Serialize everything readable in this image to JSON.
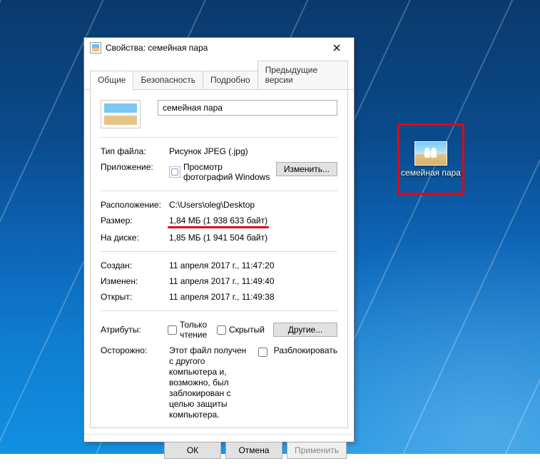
{
  "desktop_icon": {
    "label": "семейная пара"
  },
  "window": {
    "title": "Свойства: семейная пара"
  },
  "tabs": {
    "general": "Общие",
    "security": "Безопасность",
    "details": "Подробно",
    "previous": "Предыдущие версии"
  },
  "file": {
    "name": "семейная пара",
    "type_label": "Тип файла:",
    "type_value": "Рисунок JPEG (.jpg)",
    "app_label": "Приложение:",
    "app_value": "Просмотр фотографий Windows",
    "change_btn": "Изменить...",
    "location_label": "Расположение:",
    "location_value": "C:\\Users\\oleg\\Desktop",
    "size_label": "Размер:",
    "size_value": "1,84 МБ (1 938 633 байт)",
    "size_on_disk_label": "На диске:",
    "size_on_disk_value": "1,85 МБ (1 941 504 байт)",
    "created_label": "Создан:",
    "created_value": "11 апреля 2017 г., 11:47:20",
    "modified_label": "Изменен:",
    "modified_value": "11 апреля 2017 г., 11:49:40",
    "accessed_label": "Открыт:",
    "accessed_value": "11 апреля 2017 г., 11:49:38",
    "attr_label": "Атрибуты:",
    "attr_readonly": "Только чтение",
    "attr_hidden": "Скрытый",
    "attr_other_btn": "Другие...",
    "warn_label": "Осторожно:",
    "warn_text": "Этот файл получен с другого компьютера и, возможно, был заблокирован с целью защиты компьютера.",
    "unblock": "Разблокировать"
  },
  "buttons": {
    "ok": "ОК",
    "cancel": "Отмена",
    "apply": "Применить"
  }
}
